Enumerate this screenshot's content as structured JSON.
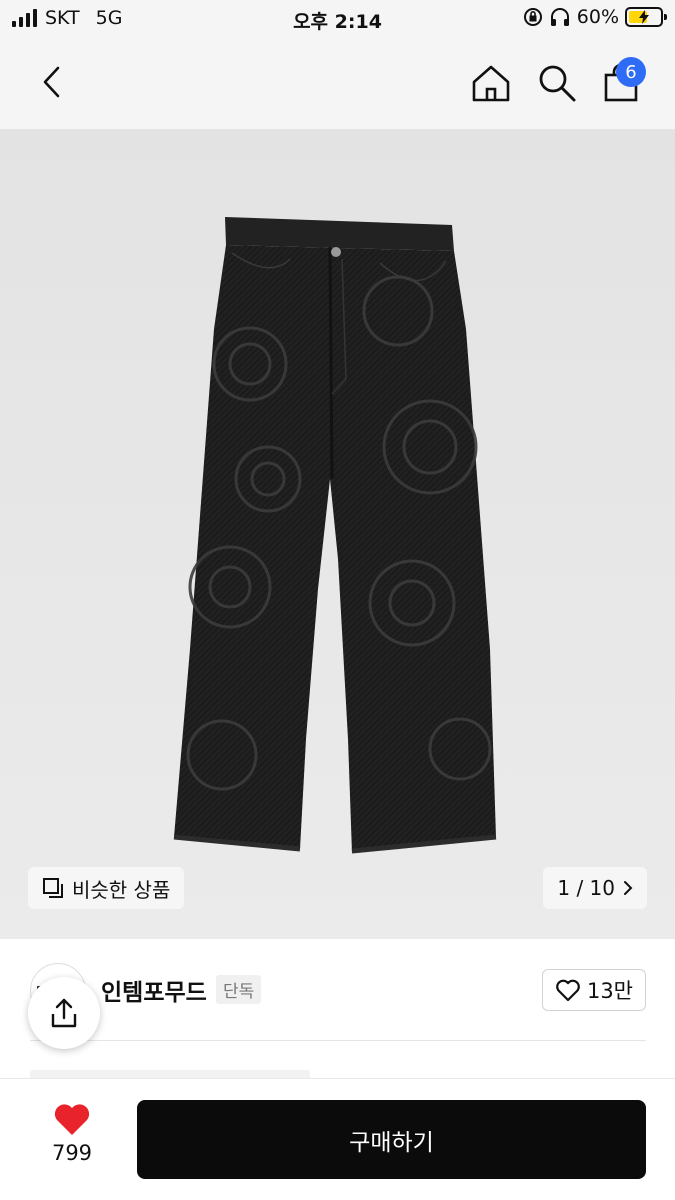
{
  "status_bar": {
    "carrier": "SKT",
    "network": "5G",
    "time": "오후 2:14",
    "battery": "60%",
    "battery_level": 0.6,
    "battery_color": "#ffd60a"
  },
  "nav": {
    "back_icon": "chevron-left-icon",
    "home_icon": "home-icon",
    "search_icon": "search-icon",
    "bag_icon": "shopping-bag-icon",
    "cart_count": "6",
    "badge_color": "#2f6cf6"
  },
  "gallery": {
    "image": "black denim wide-leg pants with tonal floral pattern",
    "similar_label": "비슷한 상품",
    "counter": "1 / 10"
  },
  "brand": {
    "name": "인템포무드",
    "tag": "단독",
    "likes": "13만"
  },
  "bottom": {
    "wish_count": "799",
    "buy_label": "구매하기",
    "heart_color": "#e8232c"
  }
}
